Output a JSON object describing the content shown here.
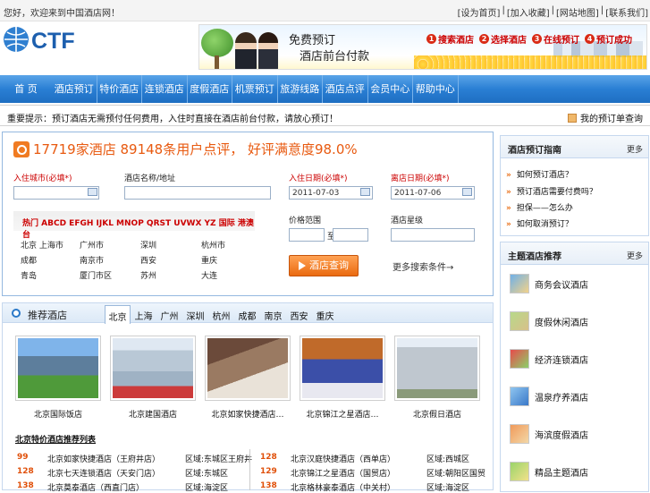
{
  "topbar": {
    "welcome": "您好，欢迎来到中国酒店网！",
    "links": [
      "[设为首页]",
      "|",
      "[加入收藏]",
      "|",
      "[网站地图]",
      "|",
      "[联系我们]"
    ]
  },
  "logo": {
    "text": "CTF"
  },
  "banner": {
    "slogan_line1": "免费预订",
    "slogan_line2": "酒店前台付款",
    "steps": [
      {
        "num": "1",
        "label": "搜索酒店"
      },
      {
        "num": "2",
        "label": "选择酒店"
      },
      {
        "num": "3",
        "label": "在线预订"
      },
      {
        "num": "4",
        "label": "预订成功"
      }
    ]
  },
  "nav": {
    "items": [
      "首 页",
      "酒店预订",
      "特价酒店",
      "连锁酒店",
      "度假酒店",
      "机票预订",
      "旅游线路",
      "酒店点评",
      "会员中心",
      "帮助中心"
    ]
  },
  "notice": {
    "text": "重要提示：预订酒店无需预付任何费用，入住时直接在酒店前台付款，请放心预订！",
    "right": "我的预订单查询"
  },
  "search": {
    "headline": "17719家酒店 89148条用户点评， 好评满意度98.0%",
    "city_label": "入住城市",
    "city_req": "(必填*)",
    "city_value": "",
    "hotel_label": "酒店名称/地址",
    "hotel_value": "",
    "checkin_label": "入住日期",
    "checkin_req": "(必填*)",
    "checkin_value": "2011-07-03",
    "checkout_label": "离店日期",
    "checkout_req": "(必填*)",
    "checkout_value": "2011-07-06",
    "price_label": "价格范围",
    "price_sep": "至",
    "star_label": "酒店星级",
    "letters": "热门 ABCD EFGH IJKL MNOP QRST UVWX YZ 国际 港澳台",
    "cities": [
      [
        "北京 上海市",
        "广州市",
        "深圳",
        "杭州市"
      ],
      [
        "成都",
        "南京市",
        "西安",
        "重庆"
      ],
      [
        "青岛",
        "厦门市区",
        "苏州",
        "大连"
      ]
    ],
    "query_button": "酒店查询",
    "adv_link": "更多搜索条件→"
  },
  "recommend": {
    "title": "推荐酒店",
    "tabs": [
      "北京",
      "上海",
      "广州",
      "深圳",
      "杭州",
      "成都",
      "南京",
      "西安",
      "重庆"
    ],
    "active_tab": 0,
    "hotels": [
      {
        "name": "北京国际饭店"
      },
      {
        "name": "北京建国酒店"
      },
      {
        "name": "北京如家快捷酒店…"
      },
      {
        "name": "北京锦江之星酒店…"
      },
      {
        "name": "北京假日酒店"
      }
    ],
    "list_title": "北京特价酒店推荐列表",
    "rows": [
      {
        "price": "99",
        "name": "北京如家快捷酒店（王府井店）",
        "area": "区域:东城区王府井",
        "price2": "128",
        "name2": "北京汉庭快捷酒店（西单店）",
        "area2": "区域:西城区"
      },
      {
        "price": "128",
        "name": "北京七天连锁酒店（天安门店）",
        "area": "区域:东城区",
        "price2": "129",
        "name2": "北京锦江之星酒店（国贸店）",
        "area2": "区域:朝阳区国贸"
      },
      {
        "price": "138",
        "name": "北京莫泰酒店（西直门店）",
        "area": "区域:海淀区",
        "price2": "138",
        "name2": "北京格林豪泰酒店（中关村）",
        "area2": "区域:海淀区"
      }
    ]
  },
  "side_news": {
    "title": "酒店预订指南",
    "more": "更多",
    "items": [
      "如何预订酒店？",
      "预订酒店需要付费吗？",
      "担保——怎么办",
      "如何取消预订？"
    ]
  },
  "side_theme": {
    "title": "主题酒店推荐",
    "more": "更多",
    "items": [
      "商务会议酒店",
      "度假休闲酒店",
      "经济连锁酒店",
      "温泉疗养酒店",
      "海滨度假酒店",
      "精品主题酒店"
    ]
  }
}
